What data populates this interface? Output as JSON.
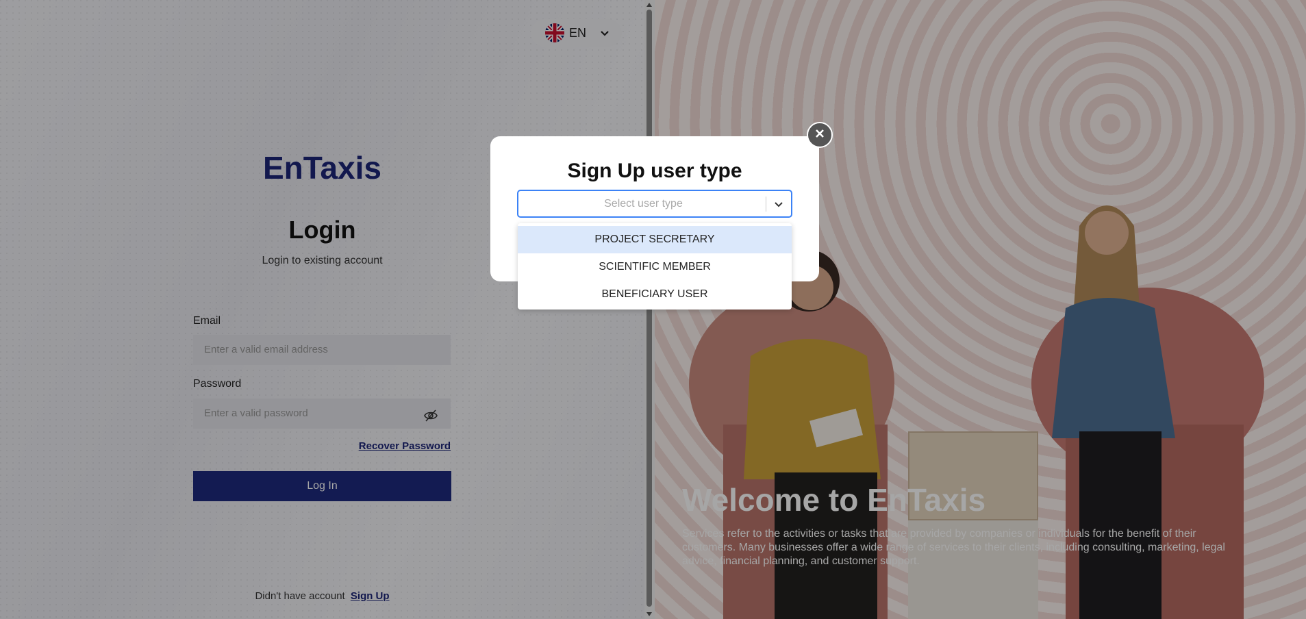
{
  "language": {
    "code": "EN",
    "flag_icon": "uk-flag-icon"
  },
  "login": {
    "brand": "EnTaxis",
    "title": "Login",
    "subtitle": "Login to existing account",
    "email_label": "Email",
    "email_placeholder": "Enter a valid email address",
    "password_label": "Password",
    "password_placeholder": "Enter a valid password",
    "recover_link": "Recover Password",
    "login_button": "Log In",
    "no_account_text": "Didn't have account",
    "signup_link": "Sign Up"
  },
  "hero": {
    "title": "Welcome to EnTaxis",
    "description": "Services refer to the activities or tasks that are provided by companies or individuals for the benefit of their customers. Many businesses offer a wide range of services to their clients, including consulting, marketing, legal advice, financial planning, and customer support."
  },
  "modal": {
    "title": "Sign Up user type",
    "select_placeholder": "Select user type",
    "options": [
      "PROJECT SECRETARY",
      "SCIENTIFIC MEMBER",
      "BENEFICIARY USER"
    ],
    "highlighted_option": "PROJECT SECRETARY"
  },
  "colors": {
    "brand": "#1d2578",
    "button": "#1e2a7e",
    "select_focus": "#3b82f6",
    "option_highlight": "#dbe8fb"
  }
}
